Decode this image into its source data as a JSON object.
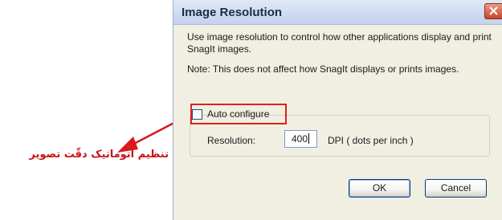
{
  "dialog": {
    "title": "Image Resolution",
    "description": "Use image resolution to control how other applications display and print SnagIt images.",
    "note": "Note: This does not affect how SnagIt displays or prints images.",
    "auto_configure_label": "Auto configure",
    "auto_configure_checked": false,
    "resolution_label": "Resolution:",
    "resolution_value": "400",
    "dpi_label": "DPI ( dots per inch )",
    "ok_label": "OK",
    "cancel_label": "Cancel"
  },
  "annotation": {
    "text": "تنظیم اتوماتیک دقّت تصویر"
  },
  "colors": {
    "highlight": "#e02020",
    "annotation": "#c8141a",
    "dialog_bg": "#f1efe2"
  },
  "icons": {
    "close": "close-icon",
    "arrow": "arrow-icon"
  }
}
